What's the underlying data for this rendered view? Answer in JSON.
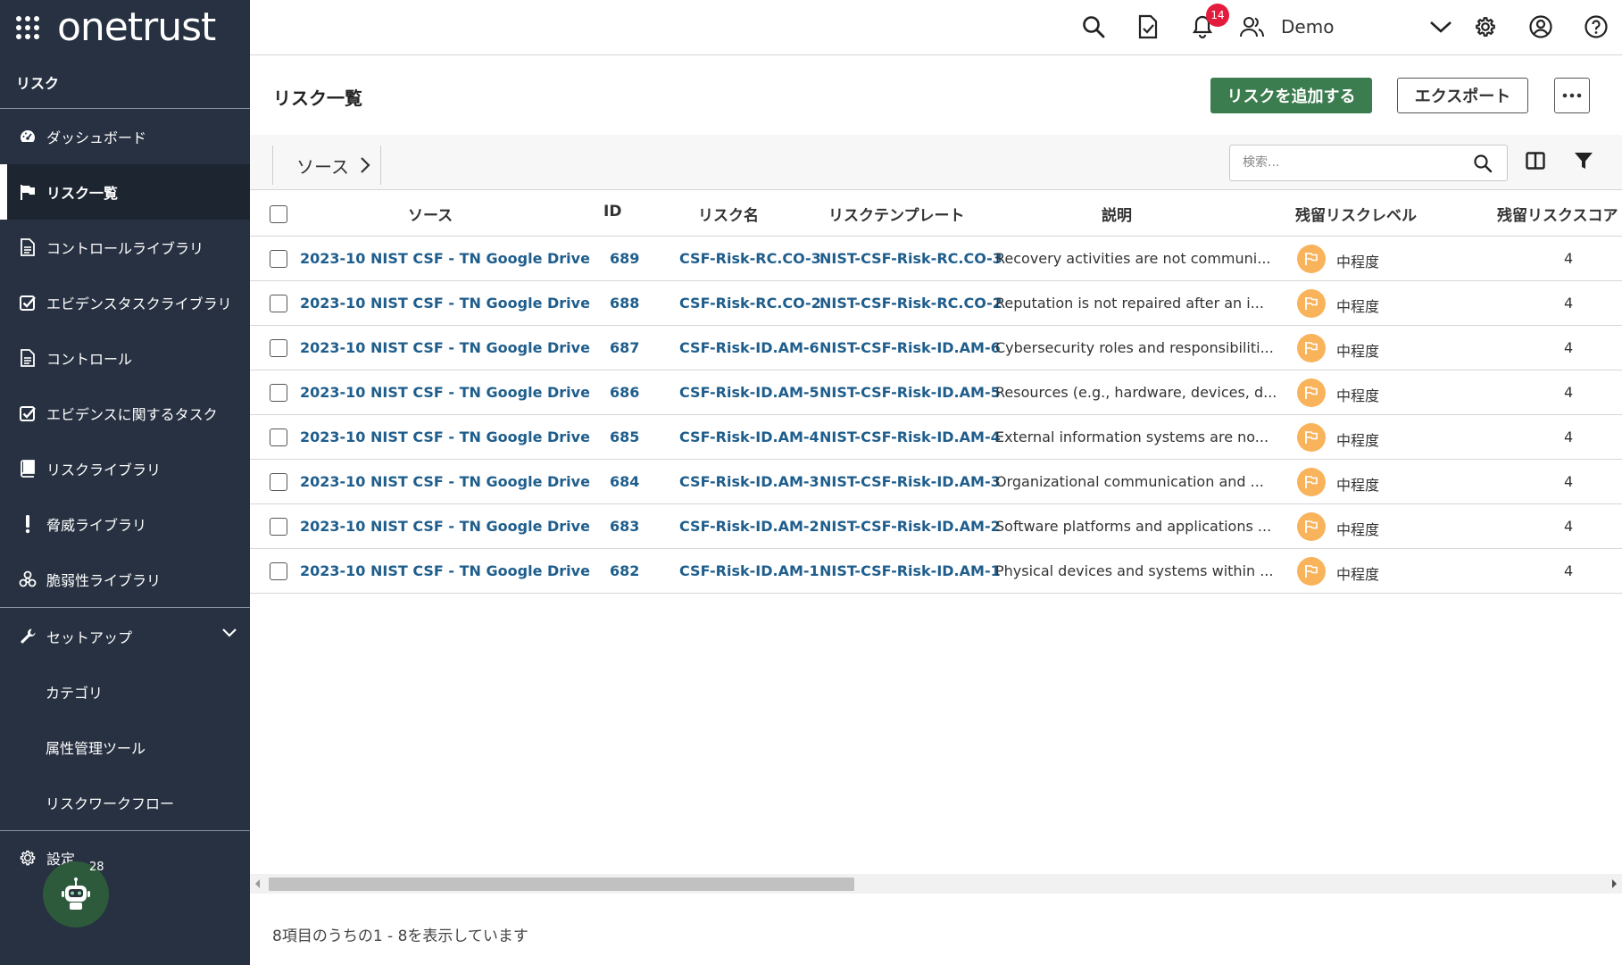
{
  "brand": {
    "logo_text": "onetrust"
  },
  "sidebar": {
    "module_title": "リスク",
    "items": [
      {
        "label": "ダッシュボード",
        "icon": "dashboard-icon"
      },
      {
        "label": "リスク一覧",
        "icon": "flag-icon",
        "active": true
      },
      {
        "label": "コントロールライブラリ",
        "icon": "document-icon"
      },
      {
        "label": "エビデンスタスクライブラリ",
        "icon": "check-square-icon"
      },
      {
        "label": "コントロール",
        "icon": "document-icon"
      },
      {
        "label": "エビデンスに関するタスク",
        "icon": "check-square-icon"
      },
      {
        "label": "リスクライブラリ",
        "icon": "book-icon"
      },
      {
        "label": "脅威ライブラリ",
        "icon": "exclamation-icon"
      },
      {
        "label": "脆弱性ライブラリ",
        "icon": "biohazard-icon"
      }
    ],
    "setup": {
      "label": "セットアップ",
      "children": [
        "カテゴリ",
        "属性管理ツール",
        "リスクワークフロー"
      ]
    },
    "settings_label": "設定",
    "bot_badge": "28"
  },
  "topbar": {
    "notification_count": "14",
    "user_name": "Demo"
  },
  "page": {
    "title": "リスク一覧",
    "add_button": "リスクを追加する",
    "export_button": "エクスポート",
    "more_button": "···",
    "breadcrumb": "ソース",
    "search_placeholder": "検索..."
  },
  "table": {
    "columns": [
      "ソース",
      "ID",
      "リスク名",
      "リスクテンプレート",
      "説明",
      "残留リスクレベル",
      "残留リスクスコア"
    ],
    "rows": [
      {
        "source": "2023-10 NIST CSF - TN Google Drive",
        "id": "689",
        "name": "CSF-Risk-RC.CO-3",
        "template": "NIST-CSF-Risk-RC.CO-3",
        "description": "Recovery activities are not communi...",
        "level": "中程度",
        "score": "4"
      },
      {
        "source": "2023-10 NIST CSF - TN Google Drive",
        "id": "688",
        "name": "CSF-Risk-RC.CO-2",
        "template": "NIST-CSF-Risk-RC.CO-2",
        "description": "Reputation is not repaired after an i...",
        "level": "中程度",
        "score": "4"
      },
      {
        "source": "2023-10 NIST CSF - TN Google Drive",
        "id": "687",
        "name": "CSF-Risk-ID.AM-6",
        "template": "NIST-CSF-Risk-ID.AM-6",
        "description": "Cybersecurity roles and responsibiliti...",
        "level": "中程度",
        "score": "4"
      },
      {
        "source": "2023-10 NIST CSF - TN Google Drive",
        "id": "686",
        "name": "CSF-Risk-ID.AM-5",
        "template": "NIST-CSF-Risk-ID.AM-5",
        "description": "Resources (e.g., hardware, devices, d...",
        "level": "中程度",
        "score": "4"
      },
      {
        "source": "2023-10 NIST CSF - TN Google Drive",
        "id": "685",
        "name": "CSF-Risk-ID.AM-4",
        "template": "NIST-CSF-Risk-ID.AM-4",
        "description": "External information systems are no...",
        "level": "中程度",
        "score": "4"
      },
      {
        "source": "2023-10 NIST CSF - TN Google Drive",
        "id": "684",
        "name": "CSF-Risk-ID.AM-3",
        "template": "NIST-CSF-Risk-ID.AM-3",
        "description": "Organizational communication and ...",
        "level": "中程度",
        "score": "4"
      },
      {
        "source": "2023-10 NIST CSF - TN Google Drive",
        "id": "683",
        "name": "CSF-Risk-ID.AM-2",
        "template": "NIST-CSF-Risk-ID.AM-2",
        "description": "Software platforms and applications ...",
        "level": "中程度",
        "score": "4"
      },
      {
        "source": "2023-10 NIST CSF - TN Google Drive",
        "id": "682",
        "name": "CSF-Risk-ID.AM-1",
        "template": "NIST-CSF-Risk-ID.AM-1",
        "description": "Physical devices and systems within ...",
        "level": "中程度",
        "score": "4"
      }
    ]
  },
  "footer": {
    "summary": "8項目のうちの1 - 8を表示しています"
  },
  "colors": {
    "sidebar_bg": "#273141",
    "accent_green": "#3c7d50",
    "link_blue": "#1f5e8c",
    "medium_level": "#f8b35b",
    "badge_red": "#e31c3d"
  }
}
